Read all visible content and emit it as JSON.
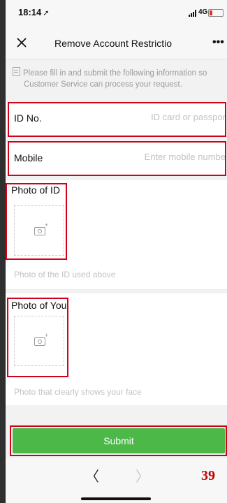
{
  "status": {
    "time": "18:14",
    "network": "4G"
  },
  "nav": {
    "title": "Remove Account Restrictio"
  },
  "notice": "Please fill in and submit the following information so Customer Service can process your request.",
  "fields": {
    "id_no": {
      "label": "ID No.",
      "placeholder": "ID card or passpor"
    },
    "mobile": {
      "label": "Mobile",
      "placeholder": "Enter mobile numbe"
    }
  },
  "photos": {
    "id": {
      "label": "Photo of ID",
      "hint": "Photo of the ID used above"
    },
    "you": {
      "label": "Photo of You",
      "hint": "Photo that clearly shows your face"
    }
  },
  "submit_label": "Submit",
  "page_number": "39",
  "colors": {
    "accent_green": "#4cb848",
    "highlight_red": "#d0021b"
  }
}
